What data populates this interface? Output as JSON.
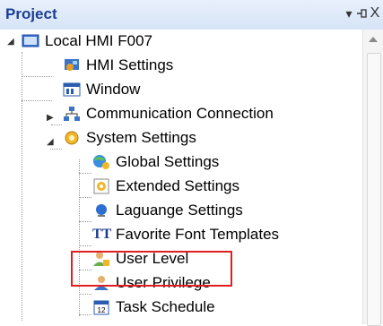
{
  "panel": {
    "title": "Project",
    "buttons": {
      "dropdown": "▾",
      "pin": "⊣",
      "close": "X"
    }
  },
  "tree": {
    "root": {
      "label": "Local HMI F007",
      "icon": "monitor-icon",
      "expanded": true
    },
    "items": [
      {
        "label": "HMI Settings",
        "icon": "hmi-settings-icon"
      },
      {
        "label": "Window",
        "icon": "window-icon"
      },
      {
        "label": "Communication Connection",
        "icon": "network-icon",
        "expandable": true,
        "expanded": false
      },
      {
        "label": "System Settings",
        "icon": "gear-folder-icon",
        "expandable": true,
        "expanded": true
      }
    ],
    "system_settings_children": [
      {
        "label": "Global Settings",
        "icon": "globe-gear-icon"
      },
      {
        "label": "Extended Settings",
        "icon": "extended-settings-icon"
      },
      {
        "label": "Laguange Settings",
        "icon": "language-pin-icon"
      },
      {
        "label": "Favorite Font Templates",
        "icon": "font-icon",
        "icon_text": "TT"
      },
      {
        "label": "User Level",
        "icon": "user-level-icon",
        "highlighted": true
      },
      {
        "label": "User Privilege",
        "icon": "user-privilege-icon"
      },
      {
        "label": "Task Schedule",
        "icon": "task-schedule-icon",
        "icon_text": "12"
      }
    ]
  },
  "colors": {
    "title_text": "#1c3f94",
    "highlight_box": "#e02020"
  }
}
